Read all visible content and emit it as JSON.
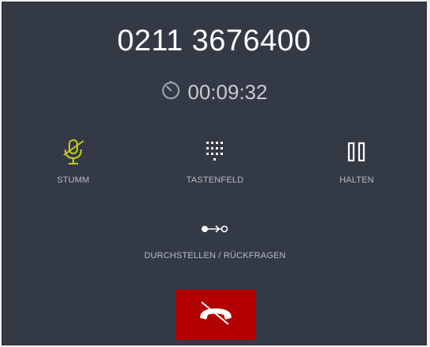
{
  "call": {
    "number": "0211 3676400",
    "duration": "00:09:32"
  },
  "controls": {
    "mute_label": "STUMM",
    "keypad_label": "TASTENFELD",
    "hold_label": "HALTEN",
    "transfer_label": "DURCHSTELLEN / RÜCKFRAGEN"
  },
  "colors": {
    "panel_background": "#343a45",
    "mute_active": "#c8c81e",
    "hangup": "#b30000"
  },
  "icons": {
    "timer": "stopwatch-icon",
    "mute": "microphone-muted-icon",
    "keypad": "dialpad-icon",
    "hold": "pause-icon",
    "transfer": "transfer-icon",
    "hangup": "hang-up-phone-icon"
  }
}
